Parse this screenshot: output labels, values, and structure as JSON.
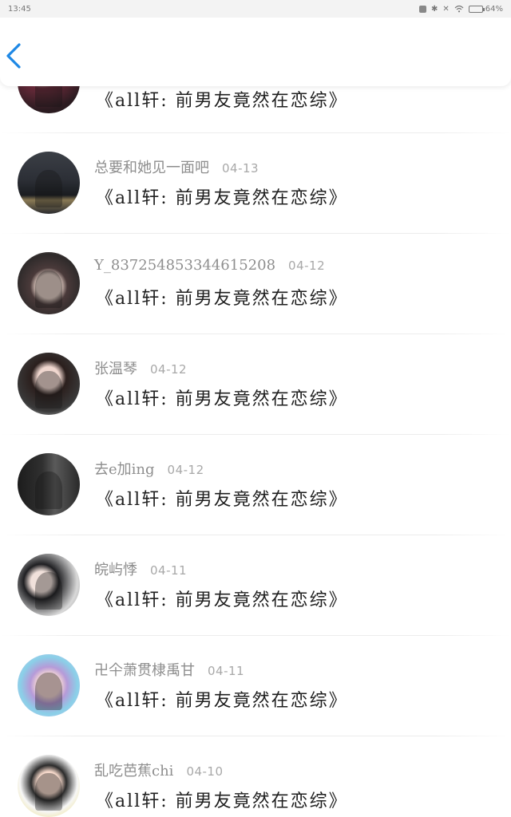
{
  "status_bar": {
    "time": "13:45",
    "battery_text": "64%",
    "battery_level": 0.64,
    "icons": [
      "nfc-icon",
      "bluetooth-icon",
      "mute-icon",
      "wifi-icon",
      "battery-icon"
    ]
  },
  "nav": {
    "back_icon": "chevron-left-icon",
    "accent": "#1e88e5"
  },
  "comments": [
    {
      "username": "",
      "date": "",
      "text": "《all轩: 前男友竟然在恋综》",
      "avatar": "avatar-dark-red"
    },
    {
      "username": "总要和她见一面吧",
      "date": "04-13",
      "text": "《all轩: 前男友竟然在恋综》",
      "avatar": "avatar-night-bridge"
    },
    {
      "username": "Y_837254853344615208",
      "date": "04-12",
      "text": "《all轩: 前男友竟然在恋综》",
      "avatar": "avatar-anime-boy"
    },
    {
      "username": "张温琴",
      "date": "04-12",
      "text": "《all轩: 前男友竟然在恋综》",
      "avatar": "avatar-girl-long-hair"
    },
    {
      "username": "去e加ing",
      "date": "04-12",
      "text": "《all轩: 前男友竟然在恋综》",
      "avatar": "avatar-dark-silhouette"
    },
    {
      "username": "皖屿悸",
      "date": "04-11",
      "text": "《all轩: 前男友竟然在恋综》",
      "avatar": "avatar-two-girls"
    },
    {
      "username": "卍仐萧贯棣禹甘",
      "date": "04-11",
      "text": "《all轩: 前男友竟然在恋综》",
      "avatar": "avatar-pastel-hair"
    },
    {
      "username": "乱吃芭蕉chi",
      "date": "04-10",
      "text": "《all轩: 前男友竟然在恋综》",
      "avatar": "avatar-cartoon-girl"
    }
  ]
}
